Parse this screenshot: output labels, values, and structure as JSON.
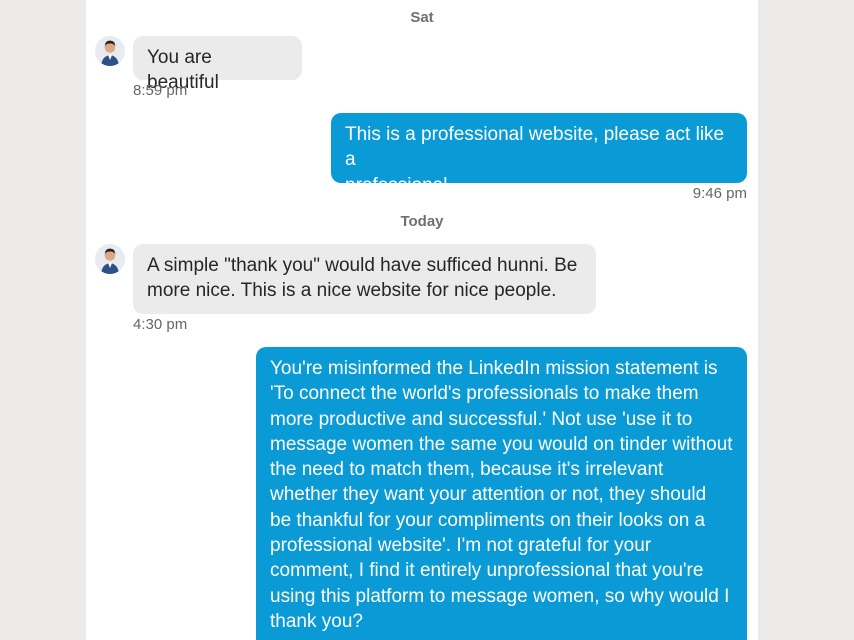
{
  "conversation": {
    "separators": {
      "sat": "Sat",
      "today": "Today"
    },
    "messages": [
      {
        "direction": "incoming",
        "text": "You are beautiful",
        "time": "8:59 pm"
      },
      {
        "direction": "outgoing",
        "text": "This is a professional website, please act like a\nprofessional.",
        "time": "9:46 pm"
      },
      {
        "direction": "incoming",
        "text": "A simple \"thank you\" would have sufficed hunni. Be\nmore nice. This is a nice website for nice people.",
        "time": "4:30 pm"
      },
      {
        "direction": "outgoing",
        "text": "You're misinformed the LinkedIn mission statement is\n'To connect the world's professionals to make them\nmore productive and successful.' Not use 'use it to\nmessage women the same you would on tinder without\nthe need to match them, because it's irrelevant\nwhether they want your attention or not, they should\nbe thankful for your compliments on their looks on a\nprofessional website'. I'm not grateful for your\ncomment, I find it entirely unprofessional that you're\nusing this platform to message women, so why would I\nthank you?"
      }
    ]
  },
  "icons": {
    "avatar": "person-avatar-icon"
  },
  "colors": {
    "outgoing_bubble": "#0a9bd6",
    "incoming_bubble": "#ecebeb",
    "page_background": "#ecebe9",
    "panel_background": "#ffffff"
  }
}
